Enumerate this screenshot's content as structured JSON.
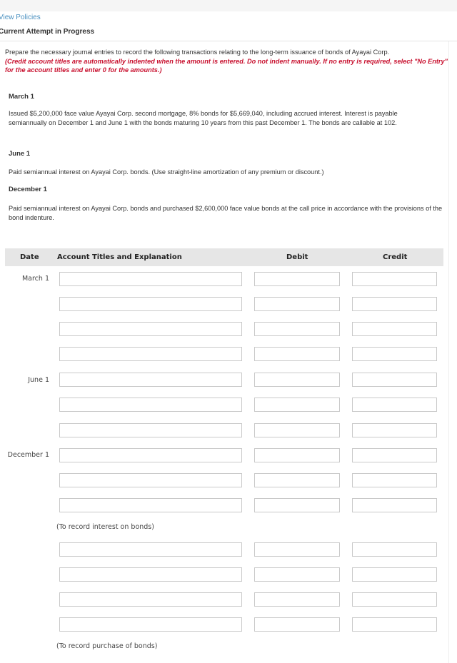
{
  "header": {
    "view_policies": "View Policies",
    "attempt_status": "Current Attempt in Progress"
  },
  "instructions": {
    "main": "Prepare the necessary journal entries to record the following transactions relating to the long-term issuance of bonds of Ayayai Corp.",
    "note": "(Credit account titles are automatically indented when the amount is entered. Do not indent manually. If no entry is required, select \"No Entry\" for the account titles and enter 0 for the amounts.)"
  },
  "transactions": [
    {
      "date": "March 1",
      "text": "Issued $5,200,000 face value Ayayai Corp. second mortgage, 8% bonds for $5,669,040, including accrued interest. Interest is payable semiannually on December 1 and June 1 with the bonds maturing 10 years from this past December 1. The bonds are callable at 102."
    },
    {
      "date": "June 1",
      "text": "Paid semiannual interest on Ayayai Corp. bonds. (Use straight-line amortization of any premium or discount.)"
    },
    {
      "date": "December 1",
      "text": "Paid semiannual interest on Ayayai Corp. bonds and purchased $2,600,000 face value bonds at the call price in accordance with the provisions of the bond indenture."
    }
  ],
  "table": {
    "headers": {
      "date": "Date",
      "account": "Account Titles and Explanation",
      "debit": "Debit",
      "credit": "Credit"
    },
    "row_dates": [
      "March 1",
      "June 1",
      "December 1"
    ],
    "memos": [
      "(To record interest on bonds)",
      "(To record purchase of bonds)"
    ],
    "rows": [
      {
        "account": "",
        "debit": "",
        "credit": ""
      },
      {
        "account": "",
        "debit": "",
        "credit": ""
      },
      {
        "account": "",
        "debit": "",
        "credit": ""
      },
      {
        "account": "",
        "debit": "",
        "credit": ""
      },
      {
        "account": "",
        "debit": "",
        "credit": ""
      },
      {
        "account": "",
        "debit": "",
        "credit": ""
      },
      {
        "account": "",
        "debit": "",
        "credit": ""
      },
      {
        "account": "",
        "debit": "",
        "credit": ""
      },
      {
        "account": "",
        "debit": "",
        "credit": ""
      },
      {
        "account": "",
        "debit": "",
        "credit": ""
      },
      {
        "account": "",
        "debit": "",
        "credit": ""
      },
      {
        "account": "",
        "debit": "",
        "credit": ""
      },
      {
        "account": "",
        "debit": "",
        "credit": ""
      },
      {
        "account": "",
        "debit": "",
        "credit": ""
      }
    ]
  }
}
